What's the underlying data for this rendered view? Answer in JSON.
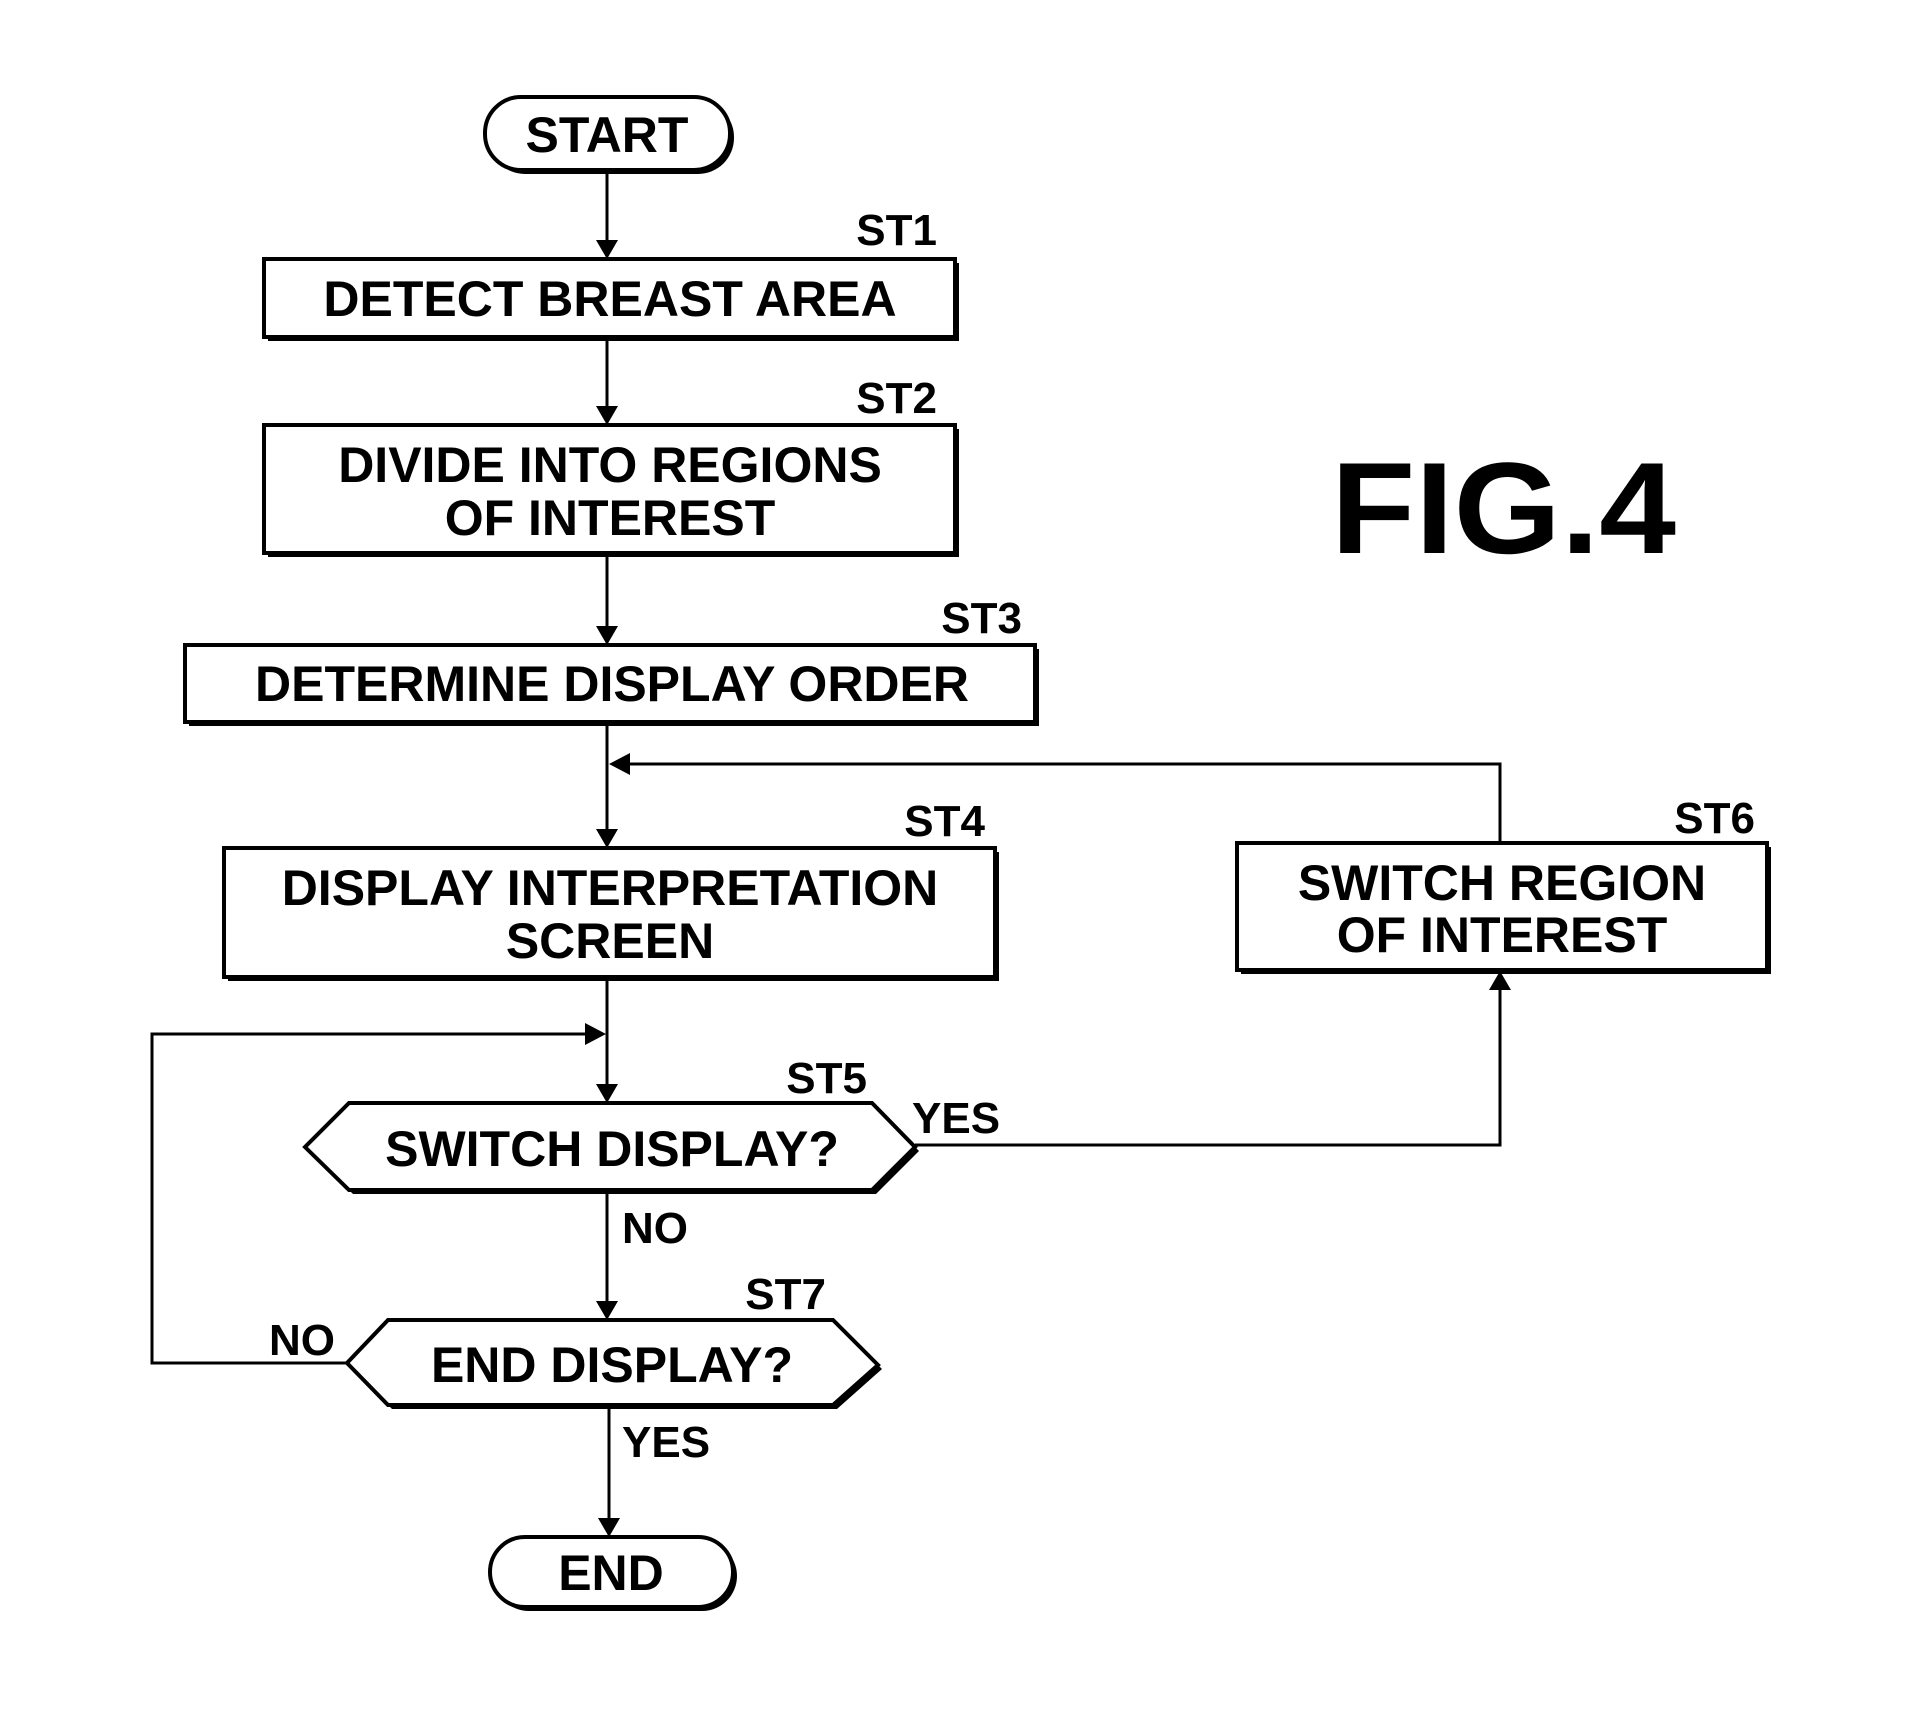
{
  "figure": {
    "title": "FIG.4"
  },
  "terminals": {
    "start": "START",
    "end": "END"
  },
  "steps": [
    {
      "id": "ST1",
      "lines": [
        "DETECT BREAST AREA"
      ]
    },
    {
      "id": "ST2",
      "lines": [
        "DIVIDE INTO REGIONS",
        "OF INTEREST"
      ]
    },
    {
      "id": "ST3",
      "lines": [
        "DETERMINE DISPLAY ORDER"
      ]
    },
    {
      "id": "ST4",
      "lines": [
        "DISPLAY INTERPRETATION",
        "SCREEN"
      ]
    },
    {
      "id": "ST5",
      "lines": [
        "SWITCH DISPLAY?"
      ]
    },
    {
      "id": "ST6",
      "lines": [
        "SWITCH REGION",
        "OF INTEREST"
      ]
    },
    {
      "id": "ST7",
      "lines": [
        "END DISPLAY?"
      ]
    }
  ],
  "branches": {
    "st5_yes": "YES",
    "st5_no": "NO",
    "st7_no": "NO",
    "st7_yes": "YES"
  }
}
